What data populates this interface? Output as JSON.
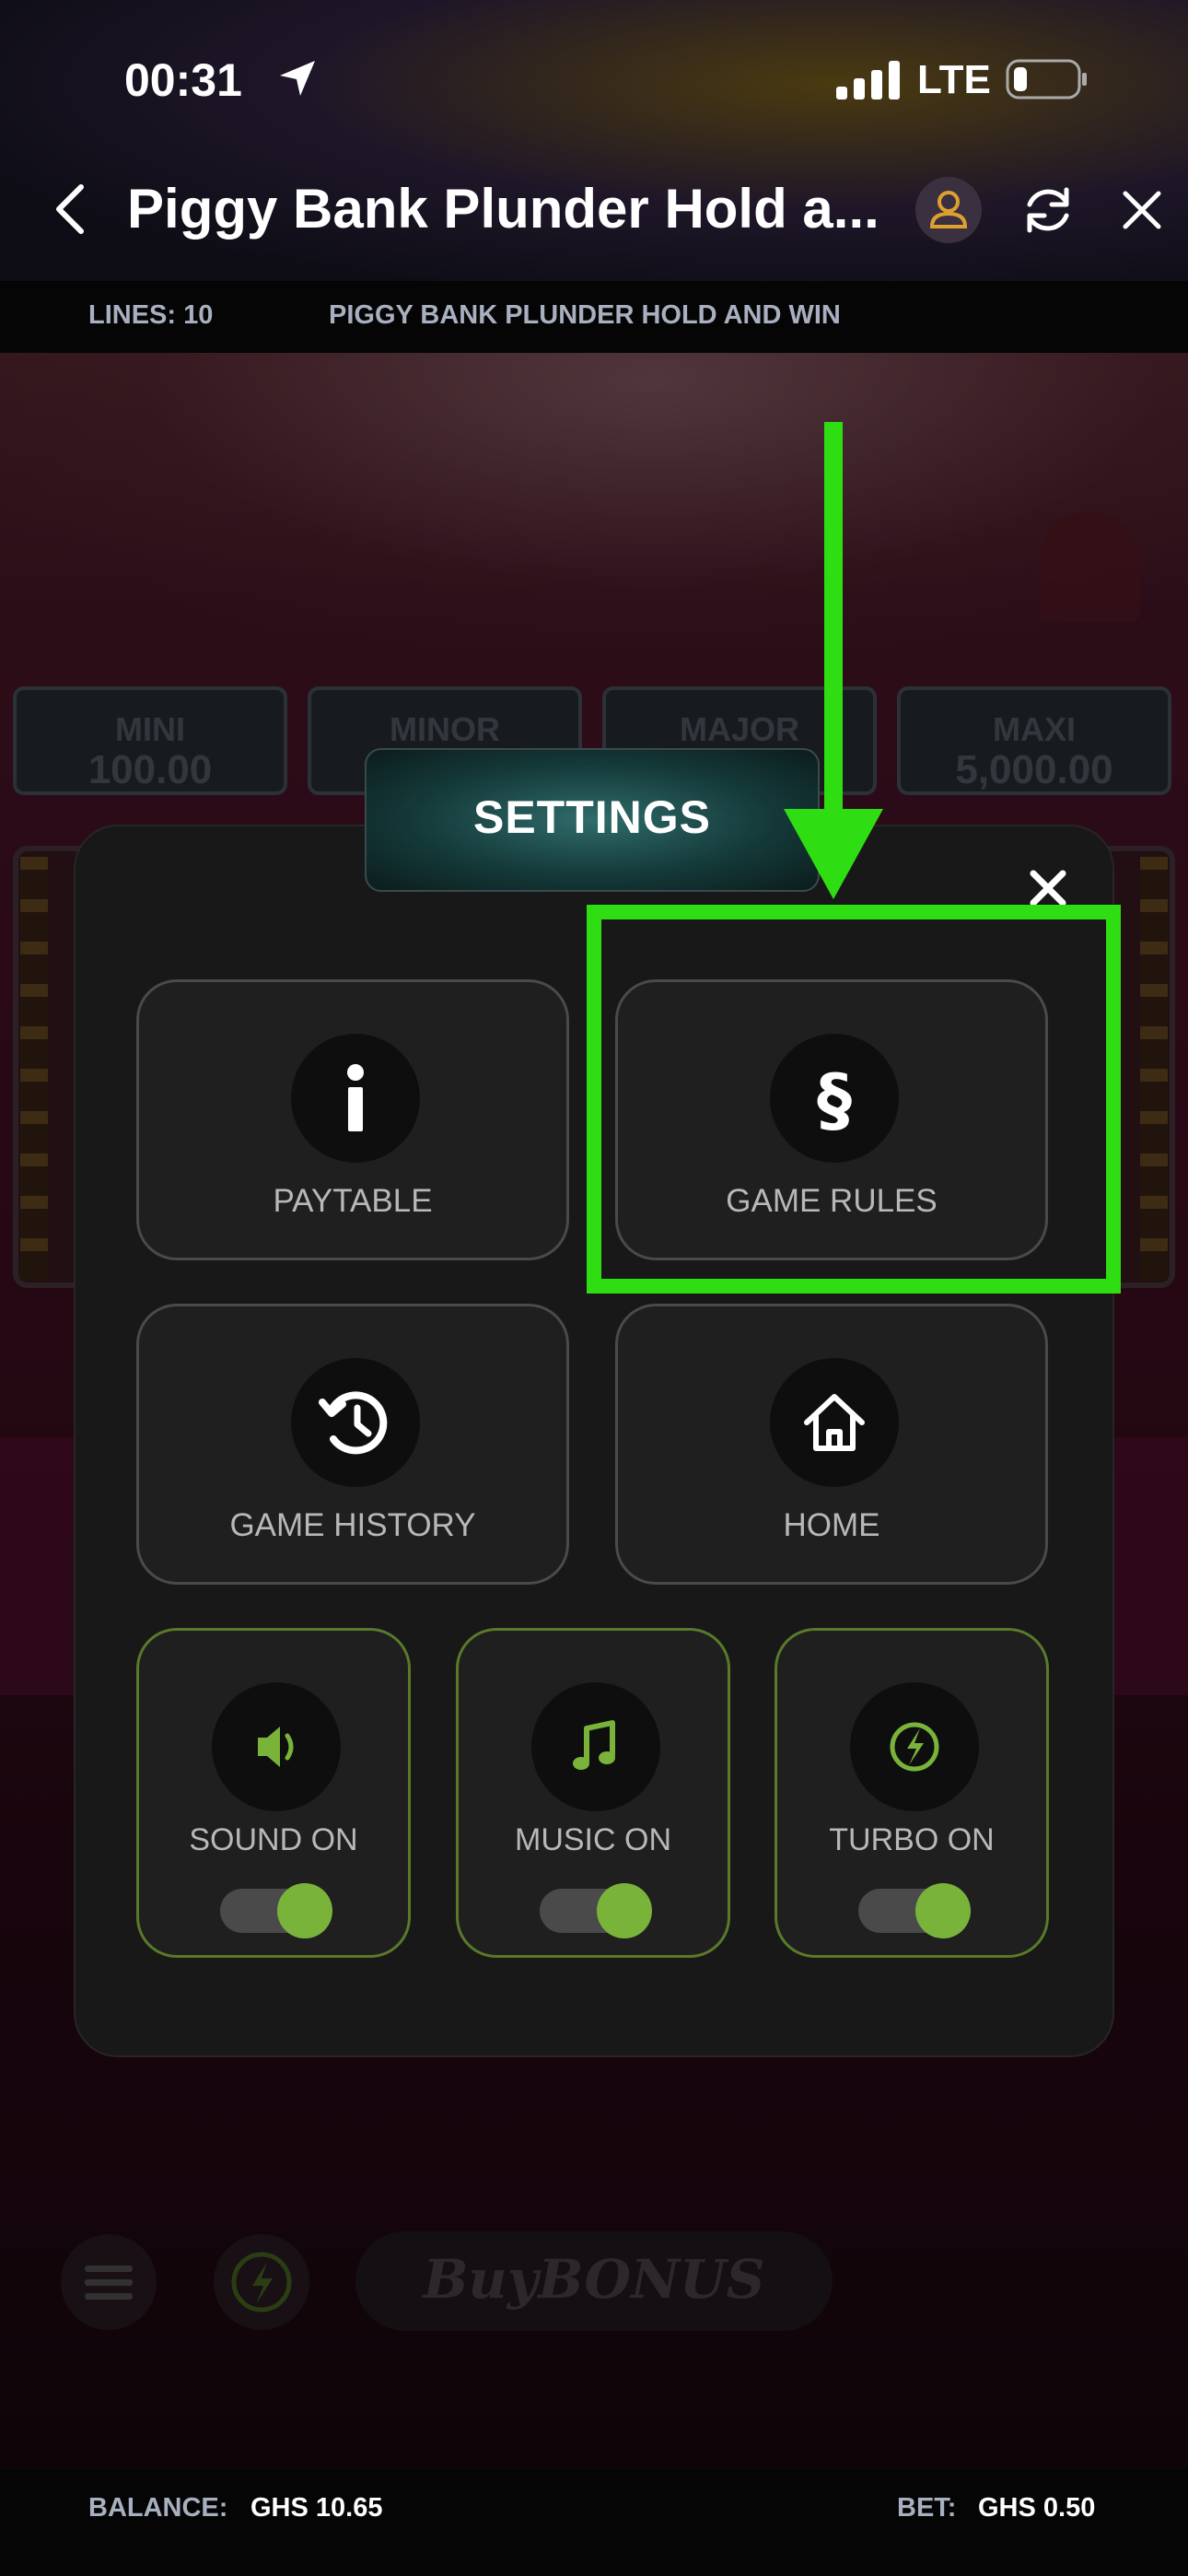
{
  "status_bar": {
    "time": "00:31",
    "network": "LTE"
  },
  "header": {
    "title": "Piggy Bank Plunder Hold a..."
  },
  "info_bar": {
    "lines": "LINES: 10",
    "game_name": "PIGGY BANK PLUNDER HOLD AND WIN"
  },
  "jackpots": [
    {
      "label": "MINI",
      "value": "100.00"
    },
    {
      "label": "MINOR",
      "value": ""
    },
    {
      "label": "MAJOR",
      "value": ""
    },
    {
      "label": "MAXI",
      "value": "5,000.00"
    }
  ],
  "settings": {
    "title": "SETTINGS",
    "tiles": [
      {
        "label": "PAYTABLE",
        "icon": "info-icon"
      },
      {
        "label": "GAME RULES",
        "icon": "section-icon"
      },
      {
        "label": "GAME HISTORY",
        "icon": "history-icon"
      },
      {
        "label": "HOME",
        "icon": "home-icon"
      }
    ],
    "toggles": [
      {
        "label": "SOUND ON",
        "icon": "speaker-icon",
        "on": true
      },
      {
        "label": "MUSIC ON",
        "icon": "music-note-icon",
        "on": true
      },
      {
        "label": "TURBO ON",
        "icon": "lightning-icon",
        "on": true
      }
    ]
  },
  "controls": {
    "buy_bonus": "BuyBONUS"
  },
  "bottom_bar": {
    "balance_label": "BALANCE:",
    "balance_value": "GHS 10.65",
    "bet_label": "BET:",
    "bet_value": "GHS 0.50"
  },
  "colors": {
    "highlight": "#2ede12",
    "toggle_on": "#7ab33a",
    "tile_border_active": "#587a2a"
  }
}
